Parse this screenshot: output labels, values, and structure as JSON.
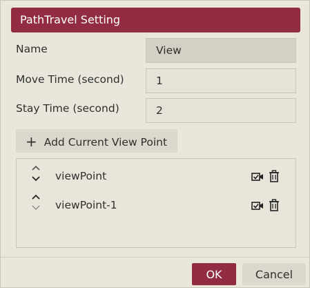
{
  "dialog": {
    "title": "PathTravel Setting"
  },
  "form": {
    "name_label": "Name",
    "name_value": "View",
    "move_label": "Move Time (second)",
    "move_value": "1",
    "stay_label": "Stay Time (second)",
    "stay_value": "2"
  },
  "add_view_point": {
    "icon": "+",
    "label": "Add Current View Point"
  },
  "view_points": [
    {
      "label": "viewPoint"
    },
    {
      "label": "viewPoint-1"
    }
  ],
  "footer": {
    "ok_label": "OK",
    "cancel_label": "Cancel"
  },
  "colors": {
    "accent": "#922c42",
    "background": "#e9e6dc"
  }
}
